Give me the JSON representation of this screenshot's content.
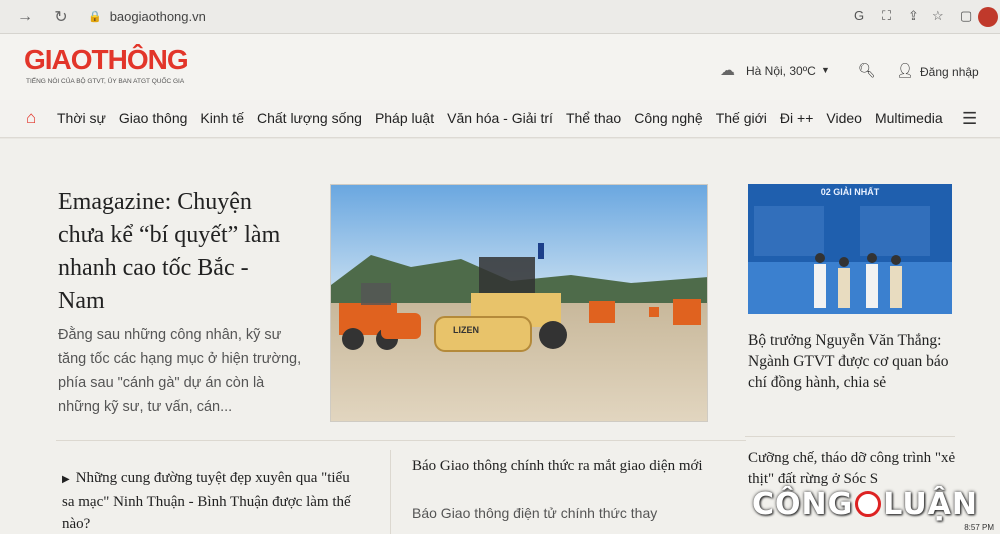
{
  "browser": {
    "url": "baogiaothong.vn",
    "extension_icons": [
      "G",
      "⛶",
      "⇪",
      "☆",
      "▢"
    ]
  },
  "site": {
    "logo": "GIAOTHÔNG",
    "tagline": "TIẾNG NÓI CỦA BỘ GTVT, ỦY BAN ATGT QUỐC GIA",
    "weather": "Hà Nội,  30ºC",
    "login": "Đăng nhập"
  },
  "nav": {
    "items": [
      "Thời sự",
      "Giao thông",
      "Kinh tế",
      "Chất lượng sống",
      "Pháp luật",
      "Văn hóa - Giải trí",
      "Thể thao",
      "Công nghệ",
      "Thế giới",
      "Đi ++",
      "Video",
      "Multimedia"
    ]
  },
  "featured": {
    "title": "Emagazine: Chuyện chưa kể “bí quyết” làm nhanh cao tốc Bắc - Nam",
    "sapo": "Đằng sau những công nhân, kỹ sư tăng tốc các hạng mục ở hiện trường, phía sau \"cánh gà\" dự án còn là những kỹ sư, tư vấn, cán...",
    "roller_brand": "LIZEN"
  },
  "side": {
    "thumb_title": "02 GIẢI NHẤT",
    "title": "Bộ trưởng Nguyễn Văn Thắng: Ngành GTVT được cơ quan báo chí đồng hành, chia sẻ"
  },
  "list": [
    {
      "title": "Những cung đường tuyệt đẹp xuyên qua \"tiểu sa mạc\" Ninh Thuận - Bình Thuận được làm thế nào?"
    },
    {
      "title": "Báo Giao thông chính thức ra mắt giao diện mới",
      "sapo": "Báo Giao thông điện tử chính thức thay"
    },
    {
      "title": "Cưỡng chế, tháo dỡ công trình \"xẻ thịt\" đất rừng ở Sóc S"
    }
  ],
  "watermark": {
    "left": "CÔNG",
    "right": "LUẬN"
  },
  "clock": "8:57 PM",
  "colors": {
    "brand_red": "#e2352a",
    "thumb_blue": "#1f5fae",
    "roller_orange": "#e0621f",
    "roller_yellow": "#e8c36a"
  }
}
